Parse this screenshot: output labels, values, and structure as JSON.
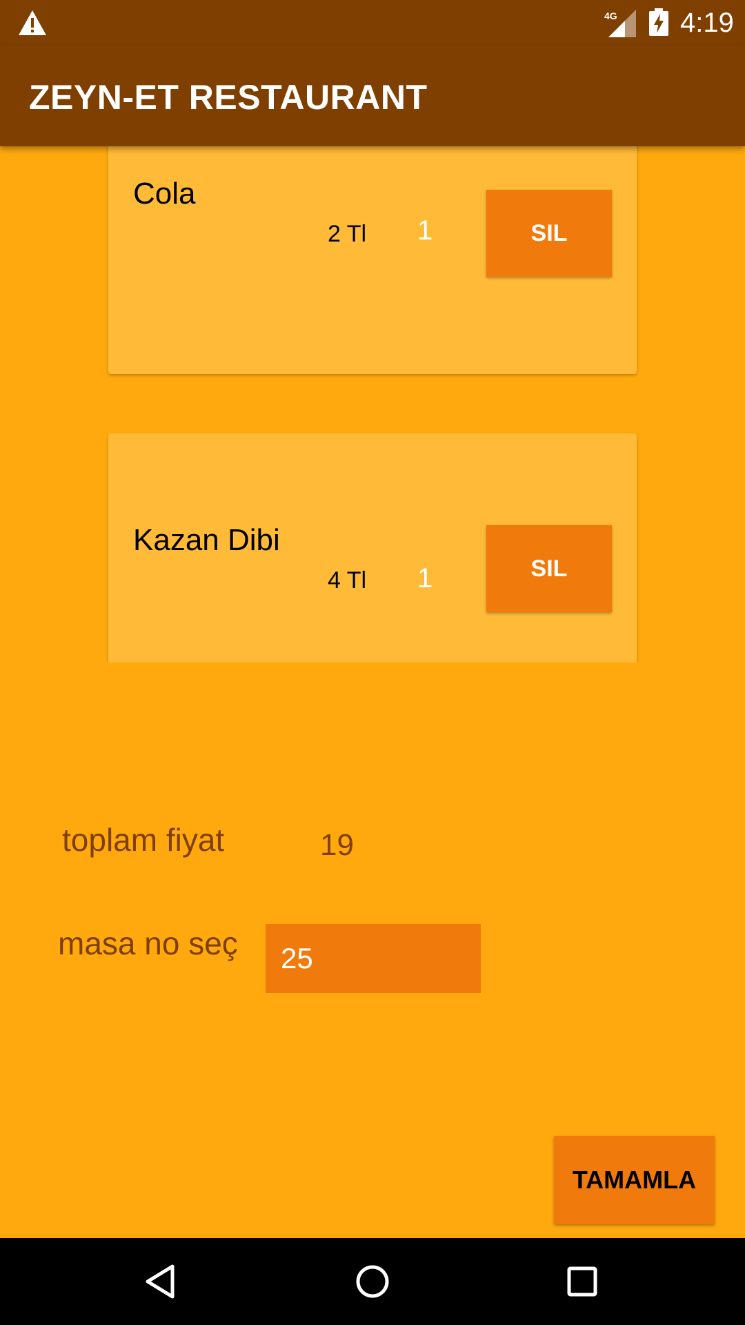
{
  "status_bar": {
    "time": "4:19",
    "network": "4G",
    "icons": [
      "warning-icon",
      "signal-icon",
      "battery-charging-icon"
    ]
  },
  "app_bar": {
    "title": "ZEYN-ET RESTAURANT"
  },
  "order_items": [
    {
      "name": "Cola",
      "price": "2 Tl",
      "quantity": "1",
      "delete_label": "SIL"
    },
    {
      "name": "Kazan Dibi",
      "price": "4 Tl",
      "quantity": "1",
      "delete_label": "SIL"
    }
  ],
  "summary": {
    "total_label": "toplam fiyat",
    "total_value": "19",
    "table_label": "masa no seç",
    "table_value": "25"
  },
  "actions": {
    "complete_label": "TAMAMLA"
  },
  "nav_bar": {
    "icons": [
      "back-icon",
      "home-icon",
      "recents-icon"
    ]
  },
  "colors": {
    "app_bar": "#7F3F00",
    "background": "#FFA90F",
    "card": "#FFBB38",
    "accent": "#F07B0C",
    "label_text": "#7F3F00"
  }
}
